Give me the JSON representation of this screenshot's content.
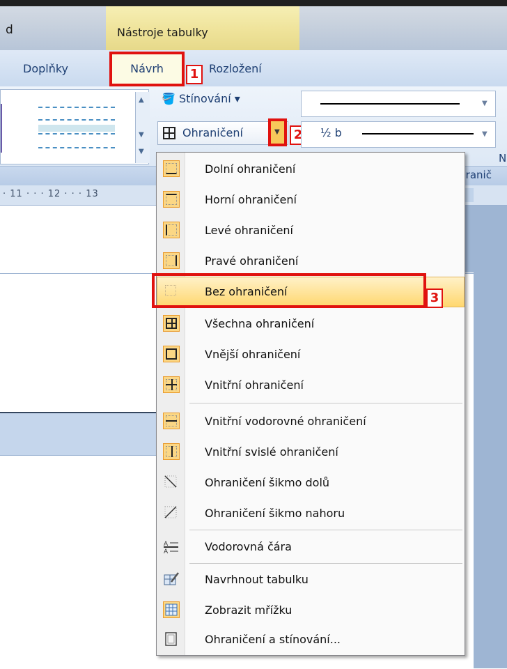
{
  "titlebar": {
    "left_text": "d",
    "tool_title": "Nástroje tabulky"
  },
  "tabs": {
    "doplnky": "Doplňky",
    "navrh": "Návrh",
    "rozlozeni": "Rozložení"
  },
  "badges": {
    "b1": "1",
    "b2": "2",
    "b3": "3"
  },
  "ribbon": {
    "shading_label": "Stínování ▾",
    "border_label": "Ohraničení",
    "line_weight_label": "½ b",
    "n_letter": "N",
    "group_label_right": "ohranič"
  },
  "ruler": {
    "text": "· 11 · · · 12 · · · 13"
  },
  "menu": {
    "items": [
      {
        "label": "Dolní ohraničení",
        "icon": "bottom-border-icon"
      },
      {
        "label": "Horní ohraničení",
        "icon": "top-border-icon"
      },
      {
        "label": "Levé ohraničení",
        "icon": "left-border-icon"
      },
      {
        "label": "Pravé ohraničení",
        "icon": "right-border-icon"
      },
      {
        "label": "Bez ohraničení",
        "icon": "no-border-icon"
      },
      {
        "label": "Všechna ohraničení",
        "icon": "all-borders-icon"
      },
      {
        "label": "Vnější ohraničení",
        "icon": "outside-borders-icon"
      },
      {
        "label": "Vnitřní ohraničení",
        "icon": "inside-borders-icon"
      },
      {
        "label": "Vnitřní vodorovné ohraničení",
        "icon": "inside-horizontal-border-icon"
      },
      {
        "label": "Vnitřní svislé ohraničení",
        "icon": "inside-vertical-border-icon"
      },
      {
        "label": "Ohraničení šikmo dolů",
        "icon": "diagonal-down-border-icon"
      },
      {
        "label": "Ohraničení šikmo nahoru",
        "icon": "diagonal-up-border-icon"
      },
      {
        "label": "Vodorovná čára",
        "icon": "horizontal-line-icon"
      },
      {
        "label": "Navrhnout tabulku",
        "icon": "draw-table-icon"
      },
      {
        "label": "Zobrazit mřížku",
        "icon": "view-gridlines-icon"
      },
      {
        "label": "Ohraničení a stínování...",
        "icon": "borders-and-shading-icon"
      }
    ],
    "highlighted": "Bez ohraničení"
  },
  "colors": {
    "annotation_red": "#e0120f",
    "hover_orange": "#ffd76e",
    "ribbon_blue": "#1e3f73"
  }
}
